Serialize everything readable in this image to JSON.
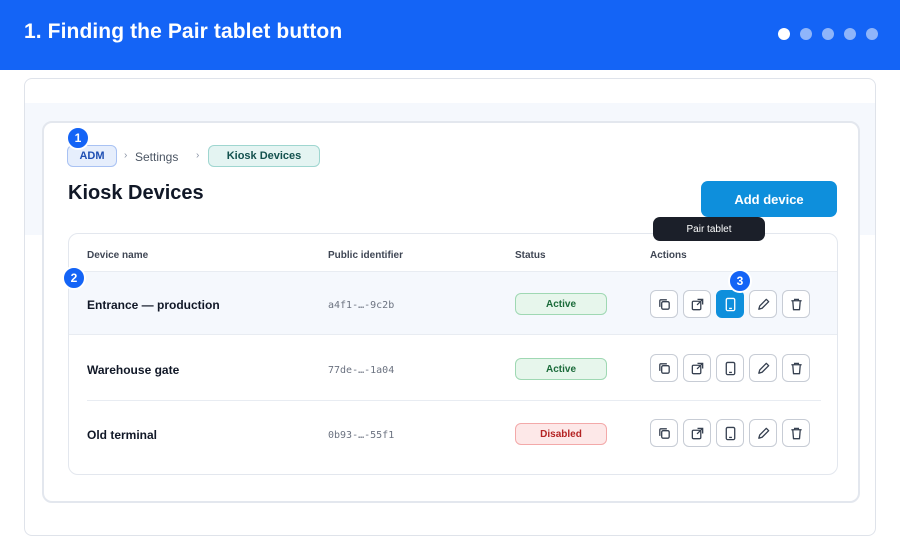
{
  "header": {
    "title": "1. Finding the Pair tablet button",
    "dots_total": 5,
    "dots_active": 1
  },
  "breadcrumb": {
    "root": "ADM",
    "separator": "›",
    "middle": "Settings",
    "current": "Kiosk Devices"
  },
  "page": {
    "title": "Kiosk Devices",
    "add_button_label": "Add device"
  },
  "table": {
    "headers": [
      "Device name",
      "Public identifier",
      "Status",
      "Actions"
    ],
    "rows": [
      {
        "name": "Entrance — production",
        "id": "a4f1-…-9c2b",
        "status": "Active",
        "status_kind": "active"
      },
      {
        "name": "Warehouse gate",
        "id": "77de-…-1a04",
        "status": "Active",
        "status_kind": "active"
      },
      {
        "name": "Old terminal",
        "id": "0b93-…-55f1",
        "status": "Disabled",
        "status_kind": "disabled"
      }
    ],
    "action_icons": [
      "copy-icon",
      "open-external-icon",
      "tablet-icon",
      "pencil-icon",
      "trash-icon"
    ]
  },
  "tooltip": {
    "text": "Pair tablet"
  },
  "steps": [
    "1",
    "2",
    "3"
  ],
  "colors": {
    "header_bg": "#1464f6",
    "primary_button": "#0e8fdc",
    "active_badge": "#e7f6ec",
    "disabled_badge": "#fde8e8"
  }
}
